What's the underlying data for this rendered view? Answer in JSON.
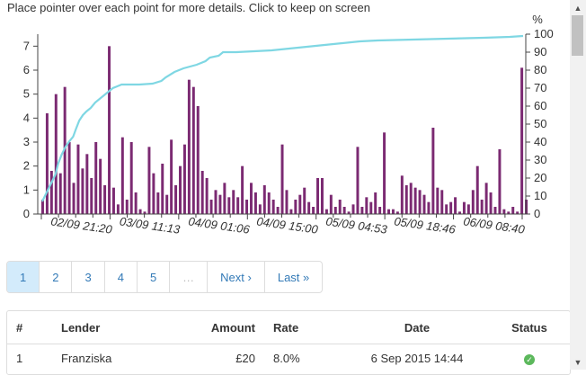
{
  "instruction": "Place pointer over each point for more details. Click to keep on screen",
  "chart_data": {
    "type": "bar+line",
    "left_axis": {
      "min": 0,
      "max": 7.5,
      "ticks": [
        0,
        1,
        2,
        3,
        4,
        5,
        6,
        7
      ]
    },
    "right_axis": {
      "unit_label": "%",
      "min": 0,
      "max": 100,
      "ticks": [
        0,
        10,
        20,
        30,
        40,
        50,
        60,
        70,
        80,
        90,
        100
      ]
    },
    "x_tick_labels": [
      "02/09 21:20",
      "03/09 11:13",
      "04/09 01:06",
      "04/09 15:00",
      "05/09 04:53",
      "05/09 18:46",
      "06/09 08:40"
    ],
    "bar_color": "#7b2a72",
    "line_color": "#7fd7e3",
    "bars": [
      0.6,
      4.2,
      1.8,
      5.0,
      1.7,
      5.3,
      3.0,
      1.3,
      2.9,
      1.9,
      2.5,
      1.5,
      3.0,
      2.3,
      1.2,
      7.0,
      1.1,
      0.4,
      3.2,
      0.6,
      3.0,
      0.9,
      0.2,
      0.1,
      2.8,
      1.7,
      0.9,
      2.1,
      0.8,
      3.1,
      1.2,
      2.0,
      2.9,
      5.6,
      5.3,
      4.5,
      1.8,
      1.5,
      0.6,
      1.0,
      0.8,
      1.3,
      0.7,
      1.0,
      0.7,
      2.0,
      0.6,
      1.3,
      0.9,
      0.4,
      1.2,
      0.9,
      0.6,
      0.3,
      2.9,
      1.0,
      0.2,
      0.6,
      0.8,
      1.1,
      0.5,
      0.3,
      1.5,
      1.5,
      0.2,
      0.8,
      0.3,
      0.6,
      0.3,
      0.1,
      0.4,
      2.8,
      0.3,
      0.7,
      0.5,
      0.9,
      0.3,
      3.4,
      0.2,
      0.2,
      0.1,
      1.6,
      1.2,
      1.3,
      1.1,
      1.0,
      0.8,
      0.5,
      3.6,
      1.1,
      1.0,
      0.4,
      0.5,
      0.7,
      0.1,
      0.5,
      0.4,
      1.0,
      2.0,
      0.6,
      1.3,
      0.9,
      0.3,
      2.7,
      0.2,
      0.1,
      0.3,
      0.1,
      6.1,
      0.6
    ],
    "cumulative_percent": [
      [
        0,
        7
      ],
      [
        5,
        12
      ],
      [
        10,
        17
      ],
      [
        15,
        22
      ],
      [
        18,
        28
      ],
      [
        22,
        33
      ],
      [
        26,
        37
      ],
      [
        30,
        40
      ],
      [
        35,
        43
      ],
      [
        38,
        47
      ],
      [
        42,
        52
      ],
      [
        46,
        55
      ],
      [
        50,
        57
      ],
      [
        55,
        59
      ],
      [
        60,
        62
      ],
      [
        65,
        64
      ],
      [
        70,
        66
      ],
      [
        75,
        68
      ],
      [
        80,
        70
      ],
      [
        85,
        71
      ],
      [
        90,
        72
      ],
      [
        100,
        72
      ],
      [
        110,
        72
      ],
      [
        125,
        72.5
      ],
      [
        135,
        74
      ],
      [
        140,
        76
      ],
      [
        150,
        79
      ],
      [
        160,
        81
      ],
      [
        175,
        83
      ],
      [
        185,
        85
      ],
      [
        190,
        87
      ],
      [
        200,
        88
      ],
      [
        205,
        90
      ],
      [
        220,
        90
      ],
      [
        240,
        90.5
      ],
      [
        260,
        91
      ],
      [
        280,
        92
      ],
      [
        300,
        93
      ],
      [
        320,
        94
      ],
      [
        340,
        95
      ],
      [
        360,
        96
      ],
      [
        380,
        96.5
      ],
      [
        420,
        97
      ],
      [
        460,
        97.5
      ],
      [
        500,
        98
      ],
      [
        530,
        98.5
      ],
      [
        545,
        99
      ]
    ]
  },
  "pagination": {
    "pages": [
      "1",
      "2",
      "3",
      "4",
      "5"
    ],
    "ellipsis": "…",
    "next": "Next ›",
    "last": "Last »"
  },
  "table": {
    "headers": {
      "num": "#",
      "lender": "Lender",
      "amount": "Amount",
      "rate": "Rate",
      "date": "Date",
      "status": "Status"
    },
    "rows": [
      {
        "num": "1",
        "lender": "Franziska",
        "amount": "£20",
        "rate": "8.0%",
        "date": "6 Sep 2015 14:44",
        "status_icon": "check-circle-icon"
      }
    ]
  },
  "scrollbar": {
    "up": "▲",
    "down": "▼"
  }
}
